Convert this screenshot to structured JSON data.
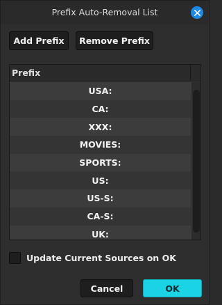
{
  "window": {
    "title": "Prefix Auto-Removal List"
  },
  "toolbar": {
    "add_label": "Add Prefix",
    "remove_label": "Remove Prefix"
  },
  "list": {
    "header": "Prefix",
    "items": [
      "USA:",
      "CA:",
      "XXX:",
      "MOVIES:",
      "SPORTS:",
      "US:",
      "US-S:",
      "CA-S:",
      "UK:"
    ]
  },
  "options": {
    "update_sources_label": "Update Current Sources on OK",
    "update_sources_checked": false
  },
  "footer": {
    "cancel_label": "Cancel",
    "ok_label": "OK"
  },
  "colors": {
    "accent": "#1ad4e6",
    "close_button": "#1e88e5",
    "background": "#2e2e2e"
  },
  "icons": {
    "close": "close-icon"
  }
}
